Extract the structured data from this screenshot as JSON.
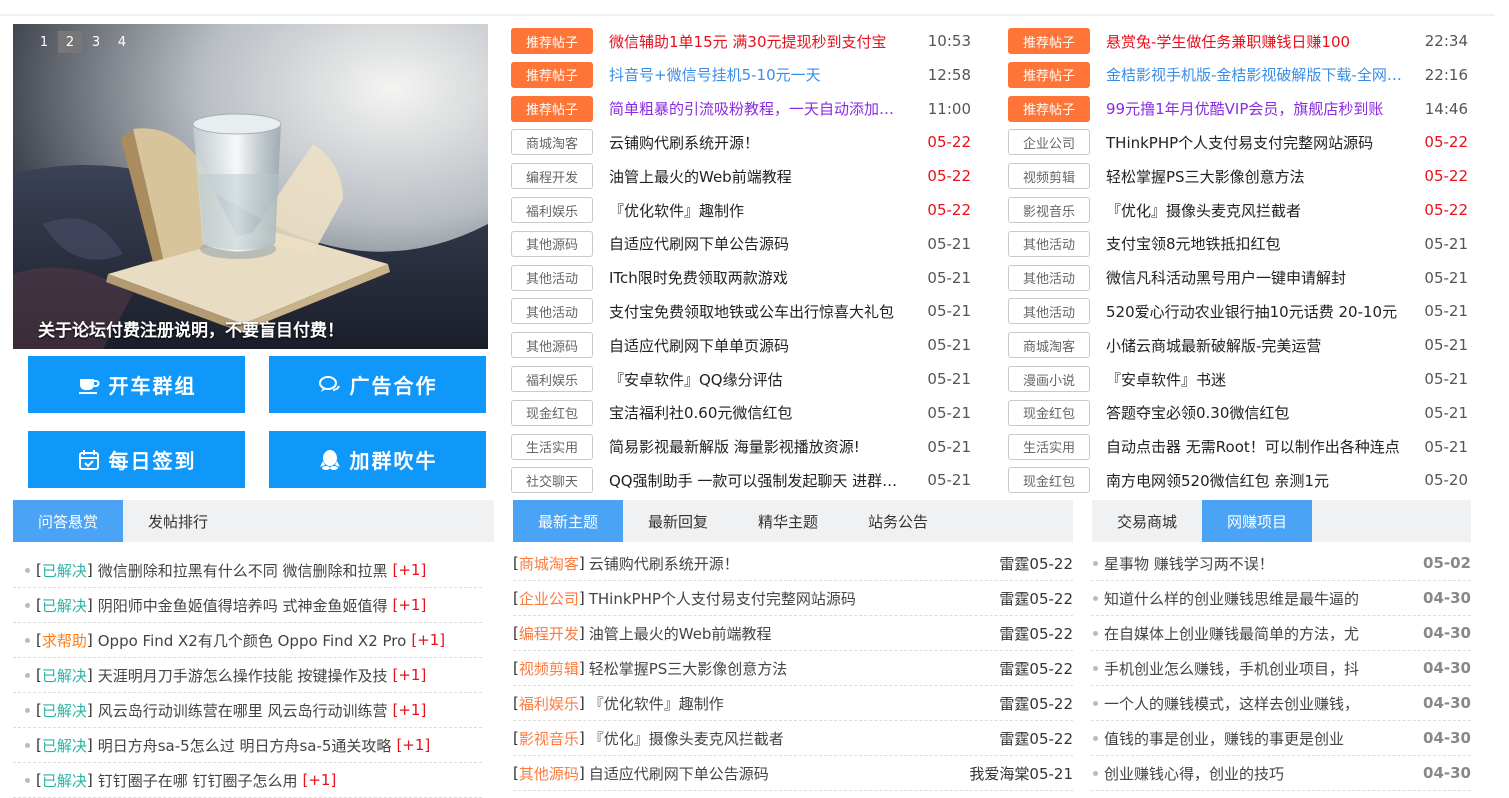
{
  "slider": {
    "pages": [
      "1",
      "2",
      "3",
      "4"
    ],
    "active": 1,
    "caption": "关于论坛付费注册说明，不要盲目付费！"
  },
  "buttons": [
    {
      "label": "开车群组",
      "icon": "coffee-cup-icon"
    },
    {
      "label": "广告合作",
      "icon": "chat-bubbles-icon"
    },
    {
      "label": "每日签到",
      "icon": "calendar-check-icon"
    },
    {
      "label": "加群吹牛",
      "icon": "qq-penguin-icon"
    }
  ],
  "posts_left": [
    {
      "tag": "推荐帖子",
      "hot": true,
      "title": "微信辅助1单15元 满30元提现秒到支付宝",
      "date": "10:53",
      "title_color": "#e8101c",
      "date_new": false
    },
    {
      "tag": "推荐帖子",
      "hot": true,
      "title": "抖音号+微信号挂机5-10元一天",
      "date": "12:58",
      "title_color": "#3a8ee6",
      "date_new": false
    },
    {
      "tag": "推荐帖子",
      "hot": true,
      "title": "简单粗暴的引流吸粉教程，一天自动添加上百人",
      "date": "11:00",
      "title_color": "#8a2be2",
      "date_new": false
    },
    {
      "tag": "商城淘客",
      "hot": false,
      "title": "云铺购代刷系统开源！",
      "date": "05-22",
      "date_new": true
    },
    {
      "tag": "编程开发",
      "hot": false,
      "title": "油管上最火的Web前端教程",
      "date": "05-22",
      "date_new": true
    },
    {
      "tag": "福利娱乐",
      "hot": false,
      "title": "『优化软件』趣制作",
      "date": "05-22",
      "date_new": true
    },
    {
      "tag": "其他源码",
      "hot": false,
      "title": "自适应代刷网下单公告源码",
      "date": "05-21",
      "date_new": false
    },
    {
      "tag": "其他活动",
      "hot": false,
      "title": "ITch限时免费领取两款游戏",
      "date": "05-21",
      "date_new": false
    },
    {
      "tag": "其他活动",
      "hot": false,
      "title": "支付宝免费领取地铁或公车出行惊喜大礼包",
      "date": "05-21",
      "date_new": false
    },
    {
      "tag": "其他源码",
      "hot": false,
      "title": "自适应代刷网下单单页源码",
      "date": "05-21",
      "date_new": false
    },
    {
      "tag": "福利娱乐",
      "hot": false,
      "title": "『安卓软件』QQ缘分评估",
      "date": "05-21",
      "date_new": false
    },
    {
      "tag": "现金红包",
      "hot": false,
      "title": "宝洁福利社0.60元微信红包",
      "date": "05-21",
      "date_new": false
    },
    {
      "tag": "生活实用",
      "hot": false,
      "title": "简易影视最新解版 海量影视播放资源!",
      "date": "05-21",
      "date_new": false
    },
    {
      "tag": "社交聊天",
      "hot": false,
      "title": "QQ强制助手 一款可以强制发起聊天 进群的软件",
      "date": "05-21",
      "date_new": false
    }
  ],
  "posts_right": [
    {
      "tag": "推荐帖子",
      "hot": true,
      "title": "悬赏兔-学生做任务兼职赚钱日赚100",
      "date": "22:34",
      "title_color": "#e8101c",
      "date_new": false
    },
    {
      "tag": "推荐帖子",
      "hot": true,
      "title": "金桔影视手机版-金桔影视破解版下载-全网影视",
      "date": "22:16",
      "title_color": "#3a8ee6",
      "date_new": false
    },
    {
      "tag": "推荐帖子",
      "hot": true,
      "title": "99元撸1年月优酷VIP会员，旗舰店秒到账",
      "date": "14:46",
      "title_color": "#8a2be2",
      "date_new": false
    },
    {
      "tag": "企业公司",
      "hot": false,
      "title": "THinkPHP个人支付易支付完整网站源码",
      "date": "05-22",
      "date_new": true
    },
    {
      "tag": "视频剪辑",
      "hot": false,
      "title": "轻松掌握PS三大影像创意方法",
      "date": "05-22",
      "date_new": true
    },
    {
      "tag": "影视音乐",
      "hot": false,
      "title": "『优化』摄像头麦克风拦截者",
      "date": "05-22",
      "date_new": true
    },
    {
      "tag": "其他活动",
      "hot": false,
      "title": "支付宝领8元地铁抵扣红包",
      "date": "05-21",
      "date_new": false
    },
    {
      "tag": "其他活动",
      "hot": false,
      "title": "微信凡科活动黑号用户一键申请解封",
      "date": "05-21",
      "date_new": false
    },
    {
      "tag": "其他活动",
      "hot": false,
      "title": "520爱心行动农业银行抽10元话费 20-10元",
      "date": "05-21",
      "date_new": false
    },
    {
      "tag": "商城淘客",
      "hot": false,
      "title": "小储云商城最新破解版-完美运营",
      "date": "05-21",
      "date_new": false
    },
    {
      "tag": "漫画小说",
      "hot": false,
      "title": "『安卓软件』书迷",
      "date": "05-21",
      "date_new": false
    },
    {
      "tag": "现金红包",
      "hot": false,
      "title": "答题夺宝必领0.30微信红包",
      "date": "05-21",
      "date_new": false
    },
    {
      "tag": "生活实用",
      "hot": false,
      "title": "自动点击器 无需Root！可以制作出各种连点",
      "date": "05-21",
      "date_new": false
    },
    {
      "tag": "现金红包",
      "hot": false,
      "title": "南方电网领520微信红包 亲测1元",
      "date": "05-20",
      "date_new": false
    }
  ],
  "qa": {
    "tabs": [
      "问答悬赏",
      "发帖排行"
    ],
    "active": 0,
    "items": [
      {
        "status": "已解决",
        "help": false,
        "title": "微信删除和拉黑有什么不同 微信删除和拉黑",
        "plus": "[+1]"
      },
      {
        "status": "已解决",
        "help": false,
        "title": "阴阳师中金鱼姬值得培养吗 式神金鱼姬值得",
        "plus": "[+1]"
      },
      {
        "status": "求帮助",
        "help": true,
        "title": "Oppo Find X2有几个颜色 Oppo Find X2 Pro",
        "plus": "[+1]"
      },
      {
        "status": "已解决",
        "help": false,
        "title": "天涯明月刀手游怎么操作技能 按键操作及技",
        "plus": "[+1]"
      },
      {
        "status": "已解决",
        "help": false,
        "title": "风云岛行动训练营在哪里 风云岛行动训练营",
        "plus": "[+1]"
      },
      {
        "status": "已解决",
        "help": false,
        "title": "明日方舟sa-5怎么过 明日方舟sa-5通关攻略",
        "plus": "[+1]"
      },
      {
        "status": "已解决",
        "help": false,
        "title": "钉钉圈子在哪 钉钉圈子怎么用",
        "plus": "[+1]"
      }
    ]
  },
  "news": {
    "tabs": [
      "最新主题",
      "最新回复",
      "精华主题",
      "站务公告"
    ],
    "active": 0,
    "items": [
      {
        "cat": "商城淘客",
        "title": "云铺购代刷系统开源！",
        "meta": "雷霆05-22"
      },
      {
        "cat": "企业公司",
        "title": "THinkPHP个人支付易支付完整网站源码",
        "meta": "雷霆05-22"
      },
      {
        "cat": "编程开发",
        "title": "油管上最火的Web前端教程",
        "meta": "雷霆05-22"
      },
      {
        "cat": "视频剪辑",
        "title": "轻松掌握PS三大影像创意方法",
        "meta": "雷霆05-22"
      },
      {
        "cat": "福利娱乐",
        "title": "『优化软件』趣制作",
        "meta": "雷霆05-22"
      },
      {
        "cat": "影视音乐",
        "title": "『优化』摄像头麦克风拦截者",
        "meta": "雷霆05-22"
      },
      {
        "cat": "其他源码",
        "title": "自适应代刷网下单公告源码",
        "meta": "我爱海棠05-21"
      }
    ]
  },
  "money": {
    "tabs": [
      "交易商城",
      "网赚项目"
    ],
    "active": 1,
    "items": [
      {
        "title": "星事物 赚钱学习两不误！",
        "date": "05-02"
      },
      {
        "title": "知道什么样的创业赚钱思维是最牛逼的",
        "date": "04-30"
      },
      {
        "title": "在自媒体上创业赚钱最简单的方法，尤",
        "date": "04-30"
      },
      {
        "title": "手机创业怎么赚钱，手机创业项目，抖",
        "date": "04-30"
      },
      {
        "title": "一个人的赚钱模式，这样去创业赚钱，",
        "date": "04-30"
      },
      {
        "title": "值钱的事是创业，赚钱的事更是创业",
        "date": "04-30"
      },
      {
        "title": "创业赚钱心得，创业的技巧",
        "date": "04-30"
      }
    ]
  }
}
